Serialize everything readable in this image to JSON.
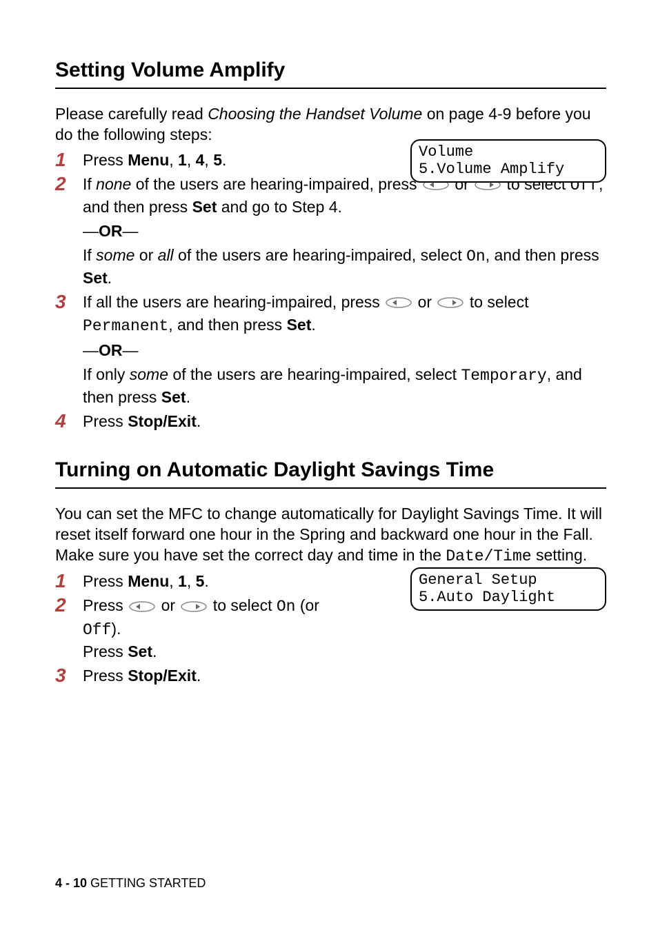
{
  "section1": {
    "heading": "Setting Volume Amplify",
    "intro_prefix": "Please carefully read ",
    "intro_italic": "Choosing the Handset Volume",
    "intro_suffix": " on page 4-9 before you do the following steps:",
    "display": {
      "line1": "Volume",
      "line2": "5.Volume Amplify"
    },
    "steps": {
      "n1": "1",
      "s1_a": "Press ",
      "s1_b": "Menu",
      "s1_c": ", ",
      "s1_d": "1",
      "s1_e": ", ",
      "s1_f": "4",
      "s1_g": ", ",
      "s1_h": "5",
      "s1_i": ".",
      "n2": "2",
      "s2_a": "If ",
      "s2_b": "none",
      "s2_c": " of the users are hearing-impaired, press ",
      "s2_d": " or ",
      "s2_e": " to select ",
      "s2_f": "Off",
      "s2_g": ", and then press ",
      "s2_h": "Set",
      "s2_i": " and go to Step 4.",
      "or": "OR",
      "s2x_a": "If ",
      "s2x_b": "some",
      "s2x_c": " or ",
      "s2x_d": "all",
      "s2x_e": " of the users are hearing-impaired, select ",
      "s2x_f": "On",
      "s2x_g": ", and then press ",
      "s2x_h": "Set",
      "s2x_i": ".",
      "n3": "3",
      "s3_a": "If all the users are hearing-impaired, press ",
      "s3_b": " or ",
      "s3_c": " to select ",
      "s3_d": "Permanent",
      "s3_e": ", and then press ",
      "s3_f": "Set",
      "s3_g": ".",
      "s3x_a": "If only ",
      "s3x_b": "some",
      "s3x_c": " of the users are hearing-impaired, select ",
      "s3x_d": "Temporary",
      "s3x_e": ", and then press ",
      "s3x_f": "Set",
      "s3x_g": ".",
      "n4": "4",
      "s4_a": "Press ",
      "s4_b": "Stop/Exit",
      "s4_c": "."
    }
  },
  "section2": {
    "heading": "Turning on Automatic Daylight Savings Time",
    "intro_a": "You can set the MFC to change automatically for Daylight Savings Time. It will reset itself forward one hour in the Spring and backward one hour in the Fall. Make sure you have set the correct day and time in the ",
    "intro_b": "Date/Time",
    "intro_c": " setting.",
    "display": {
      "line1": "General Setup",
      "line2": "5.Auto Daylight"
    },
    "steps": {
      "n1": "1",
      "s1_a": "Press ",
      "s1_b": "Menu",
      "s1_c": ", ",
      "s1_d": "1",
      "s1_e": ", ",
      "s1_f": "5",
      "s1_g": ".",
      "n2": "2",
      "s2_a": "Press ",
      "s2_b": " or ",
      "s2_c": " to select ",
      "s2_d": "On",
      "s2_e": " (or ",
      "s2_f": "Off",
      "s2_g": ").",
      "s2p_a": "Press ",
      "s2p_b": "Set",
      "s2p_c": ".",
      "n3": "3",
      "s3_a": "Press ",
      "s3_b": "Stop/Exit",
      "s3_c": "."
    }
  },
  "footer": {
    "page": "4 - 10",
    "chapter": "   GETTING STARTED"
  },
  "icons": {
    "nav_left": "nav-left-icon",
    "nav_right": "nav-right-icon"
  }
}
